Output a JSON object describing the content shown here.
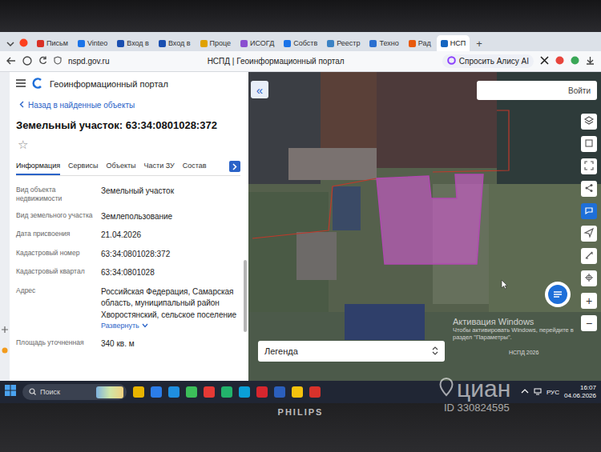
{
  "browser": {
    "tabs": [
      {
        "label": "Письм",
        "selected": false,
        "color": "#d93025"
      },
      {
        "label": "Vinteo",
        "selected": false,
        "color": "#1a73e8"
      },
      {
        "label": "Вход в",
        "selected": false,
        "color": "#1a4fb0"
      },
      {
        "label": "Вход в",
        "selected": false,
        "color": "#1a4fb0"
      },
      {
        "label": "Проце",
        "selected": false,
        "color": "#e0a200"
      },
      {
        "label": "ИСОГД",
        "selected": false,
        "color": "#8a4fd0"
      },
      {
        "label": "Собств",
        "selected": false,
        "color": "#1a73e8"
      },
      {
        "label": "Реестр",
        "selected": false,
        "color": "#3b82c4"
      },
      {
        "label": "Техно",
        "selected": false,
        "color": "#2a6fd0"
      },
      {
        "label": "Рад",
        "selected": false,
        "color": "#e8590c"
      },
      {
        "label": "НСП",
        "selected": true,
        "color": "#1565c0"
      }
    ],
    "new_tab": "+",
    "address": "nspd.gov.ru",
    "page_title": "НСПД | Геоинформационный портал",
    "alice": "Спросить Алису AI"
  },
  "panel": {
    "title": "Геоинформационный портал",
    "back": "Назад в найденные объекты",
    "heading": "Земельный участок: 63:34:0801028:372",
    "star": "☆",
    "tabs": [
      {
        "label": "Информация",
        "selected": true
      },
      {
        "label": "Сервисы",
        "selected": false
      },
      {
        "label": "Объекты",
        "selected": false
      },
      {
        "label": "Части ЗУ",
        "selected": false
      },
      {
        "label": "Состав",
        "selected": false
      }
    ],
    "fields": [
      {
        "label": "Вид объекта недвижимости",
        "value": "Земельный участок"
      },
      {
        "label": "Вид земельного участка",
        "value": "Землепользование"
      },
      {
        "label": "Дата присвоения",
        "value": "21.04.2026"
      },
      {
        "label": "Кадастровый номер",
        "value": "63:34:0801028:372"
      },
      {
        "label": "Кадастровый квартал",
        "value": "63:34:0801028"
      },
      {
        "label": "Адрес",
        "value": "Российская Федерация, Самарская область, муниципальный район Хворостянский, сельское поселение",
        "more": "Развернуть"
      },
      {
        "label": "Площадь уточненная",
        "value": "340 кв. м"
      }
    ]
  },
  "map": {
    "collapse": "«",
    "login": "Войти",
    "legend": "Легенда",
    "credit": "НСПД 2026",
    "zoom_in": "+",
    "zoom_out": "−",
    "activation": {
      "title": "Активация Windows",
      "text": "Чтобы активировать Windows, перейдите в раздел \"Параметры\"."
    }
  },
  "taskbar": {
    "search": "Поиск",
    "lang": "РУС",
    "time": "16:07",
    "date": "04.06.2026"
  },
  "monitor": {
    "brand": "PHILIPS"
  },
  "watermark": {
    "brand": "циан",
    "id": "ID 330824595"
  }
}
